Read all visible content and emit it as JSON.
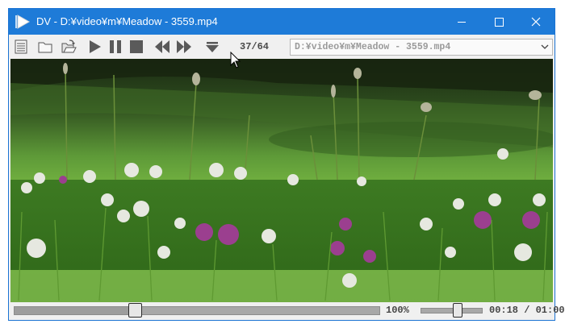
{
  "window": {
    "title": "DV - D:¥video¥m¥Meadow - 3559.mp4",
    "controls": {
      "minimize": "minimize-icon",
      "maximize": "maximize-icon",
      "close": "close-icon"
    }
  },
  "toolbar": {
    "buttons": [
      "playlist-icon",
      "open-folder-icon",
      "open-file-icon",
      "play-icon",
      "pause-icon",
      "stop-icon",
      "rewind-icon",
      "fast-forward-icon",
      "eject-icon"
    ],
    "counter": "37/64",
    "path": "D:¥video¥m¥Meadow - 3559.mp4"
  },
  "status": {
    "progress": 0.33,
    "zoom": "100%",
    "volume": 0.6,
    "time": "00:18 / 01:00"
  },
  "colors": {
    "titlebar": "#1e7bd8",
    "chrome": "#f0f0f0",
    "grass": "#4e8a2c"
  }
}
